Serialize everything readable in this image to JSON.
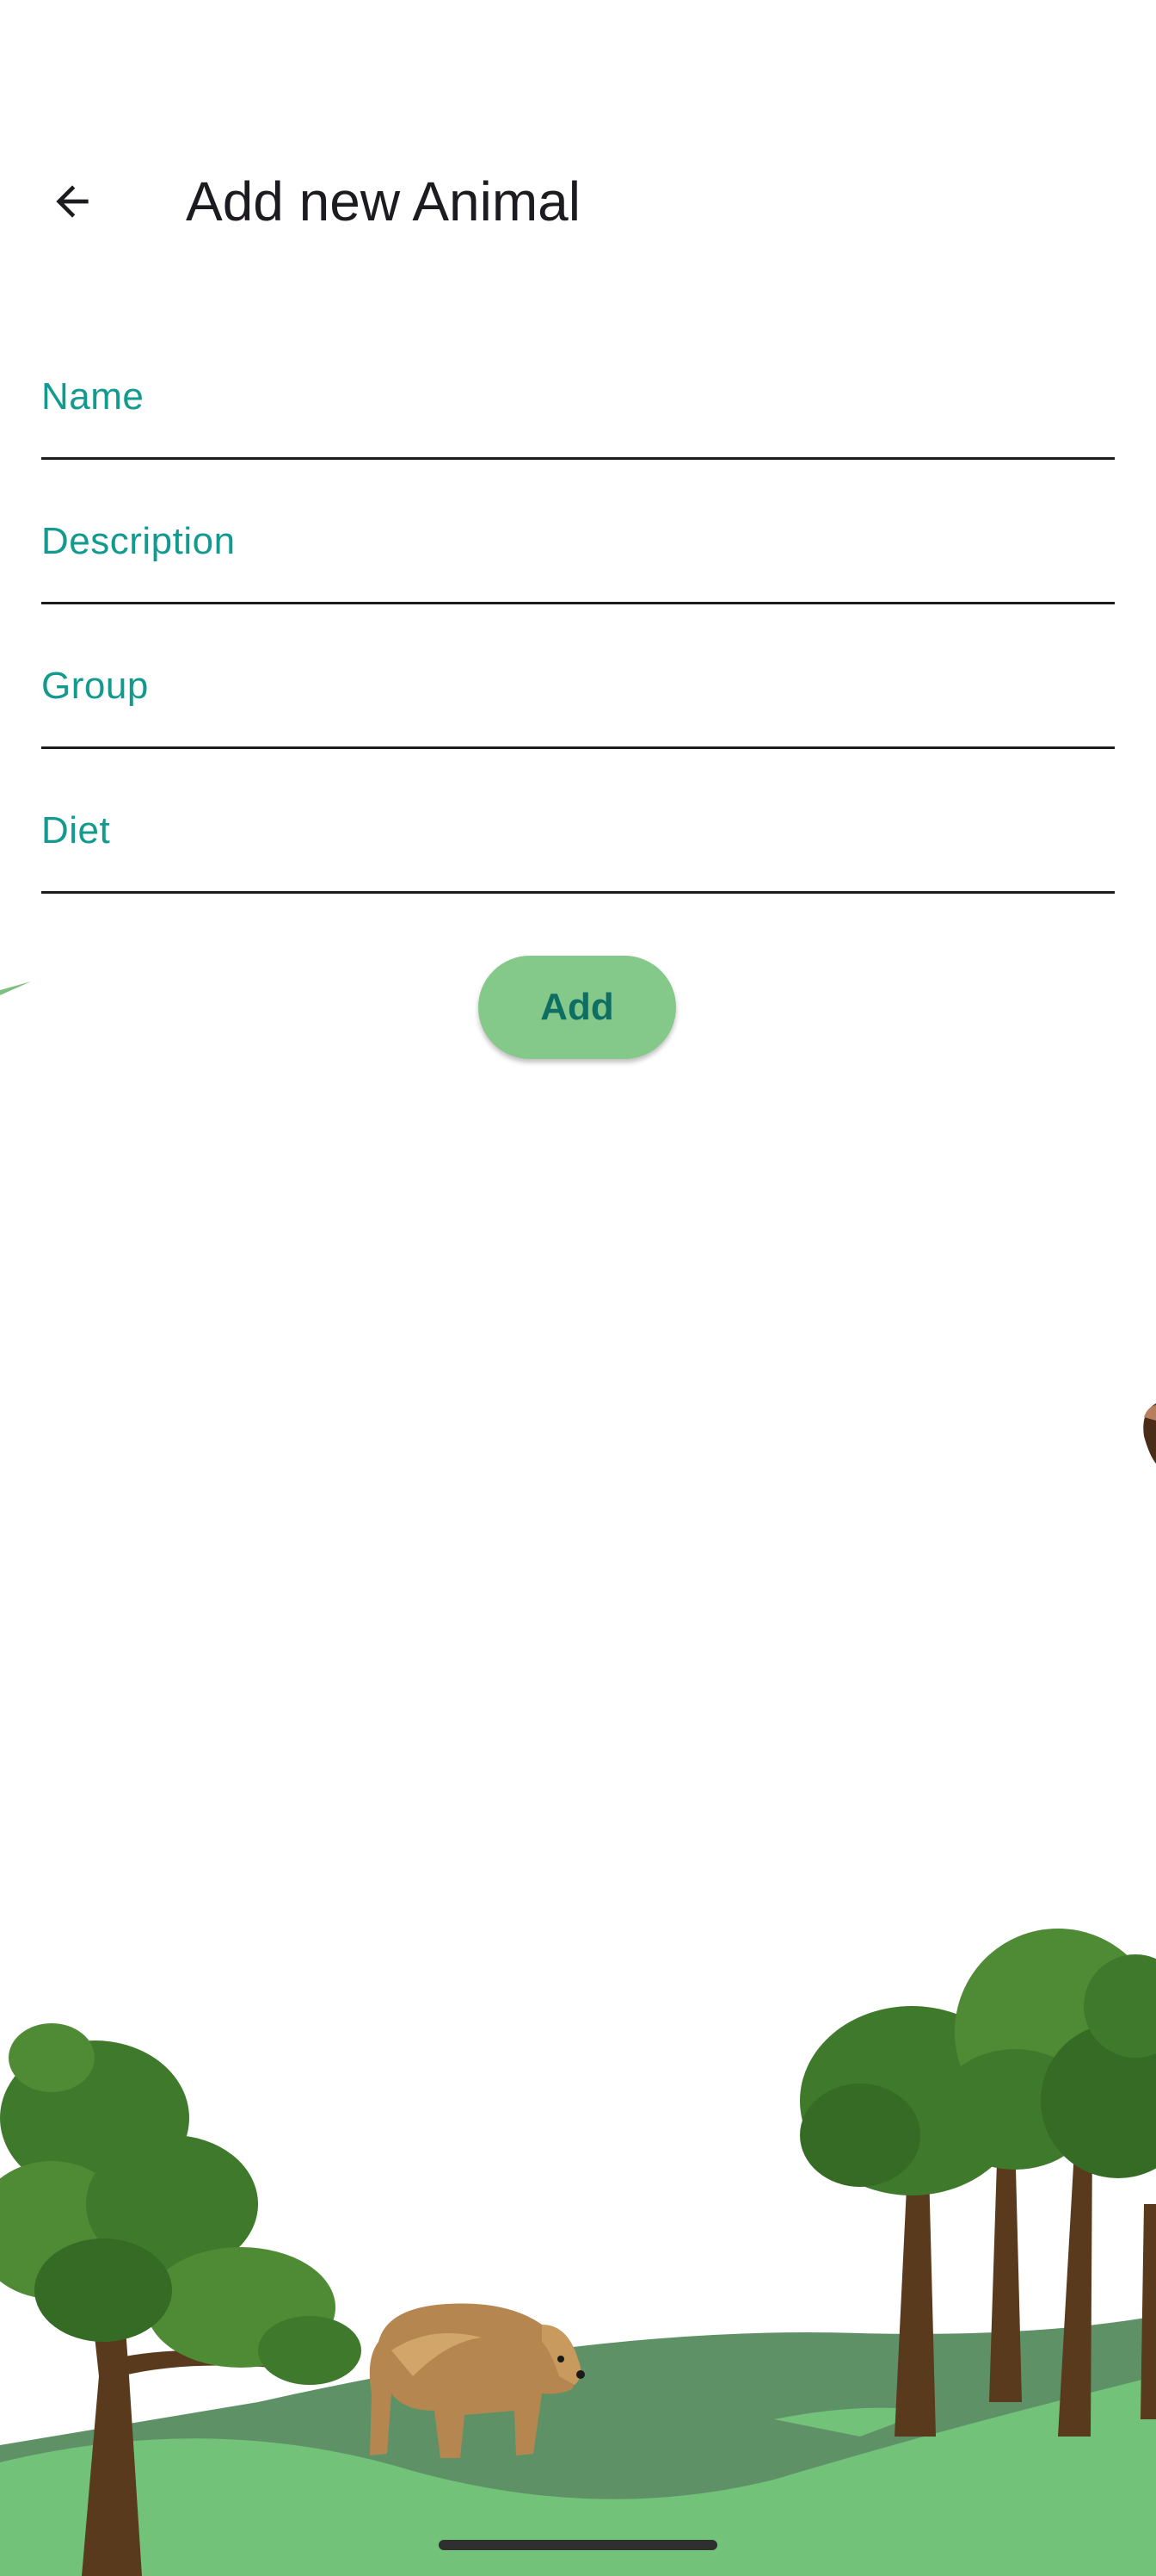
{
  "app_bar": {
    "title": "Add new Animal",
    "back_icon": "arrow-back-icon"
  },
  "form": {
    "fields": [
      {
        "label": "Name",
        "value": ""
      },
      {
        "label": "Description",
        "value": ""
      },
      {
        "label": "Group",
        "value": ""
      },
      {
        "label": "Diet",
        "value": ""
      }
    ],
    "submit_label": "Add"
  },
  "colors": {
    "label": "#139a8e",
    "button_bg": "#85c98a",
    "button_text": "#0f6e64",
    "grass": "#72c27a",
    "hill_shade": "#5e9266",
    "tree_leaves": "#3f7a2c",
    "trunk": "#5a3a1c"
  },
  "illustration": {
    "icons": [
      "bear-illustration",
      "tree-illustration",
      "hill-illustration"
    ]
  }
}
